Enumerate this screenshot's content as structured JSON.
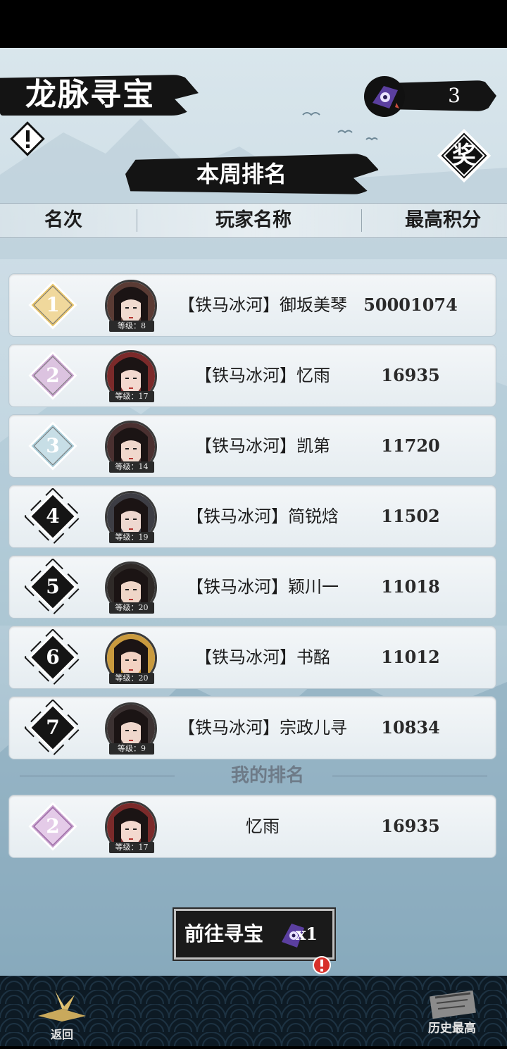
{
  "header": {
    "title": "龙脉寻宝",
    "token_count": "3",
    "warning_icon": "exclamation-diamond-icon",
    "reward_label": "奖"
  },
  "ranking": {
    "section_title": "本周排名",
    "columns": [
      "名次",
      "玩家名称",
      "最高积分"
    ],
    "rows": [
      {
        "rank": "1",
        "name": "【铁马冰河】御坂美琴",
        "score": "50001074",
        "level": "等级：8",
        "badge_color": "#e8c468",
        "num_color": "#ffffff"
      },
      {
        "rank": "2",
        "name": "【铁马冰河】忆雨",
        "score": "16935",
        "level": "等级：17",
        "badge_color": "#c9a3cf",
        "num_color": "#ffffff"
      },
      {
        "rank": "3",
        "name": "【铁马冰河】凯第",
        "score": "11720",
        "level": "等级：14",
        "badge_color": "#a9cdd9",
        "num_color": "#ffffff"
      },
      {
        "rank": "4",
        "name": "【铁马冰河】简锐焓",
        "score": "11502",
        "level": "等级：19",
        "badge_color": "#151515",
        "num_color": "#ffffff"
      },
      {
        "rank": "5",
        "name": "【铁马冰河】颖川一",
        "score": "11018",
        "level": "等级：20",
        "badge_color": "#151515",
        "num_color": "#ffffff"
      },
      {
        "rank": "6",
        "name": "【铁马冰河】书酩",
        "score": "11012",
        "level": "等级：20",
        "badge_color": "#151515",
        "num_color": "#ffffff"
      },
      {
        "rank": "7",
        "name": "【铁马冰河】宗政儿寻",
        "score": "10834",
        "level": "等级：9",
        "badge_color": "#151515",
        "num_color": "#ffffff"
      }
    ]
  },
  "my_rank": {
    "label": "我的排名",
    "rank": "2",
    "name": "忆雨",
    "score": "16935",
    "level": "等级：17"
  },
  "actions": {
    "go_treasure": "前往寻宝",
    "go_multiplier": "x1"
  },
  "footer": {
    "back_label": "返回",
    "history_label": "历史最高"
  }
}
